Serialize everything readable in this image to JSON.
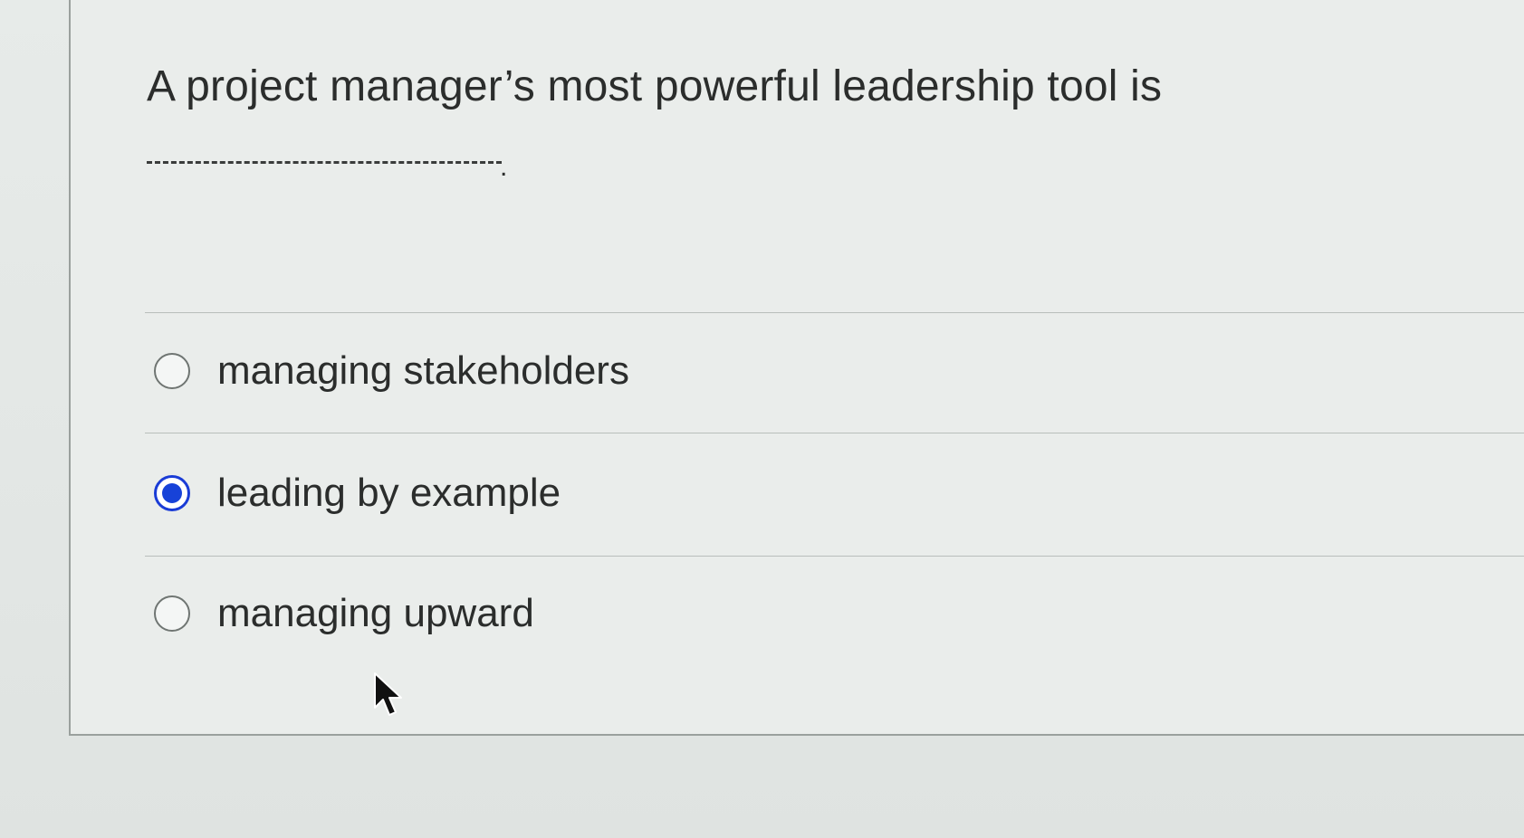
{
  "question": {
    "text": "A project manager’s most powerful leadership tool is",
    "blank_period": "."
  },
  "answers": [
    {
      "label": "managing stakeholders",
      "selected": false
    },
    {
      "label": "leading by example",
      "selected": true
    },
    {
      "label": "managing upward",
      "selected": false
    }
  ],
  "colors": {
    "selected_radio": "#1742d8",
    "text": "#2b2d2c"
  },
  "icons": {
    "cursor": "mouse-pointer-arrow-icon"
  }
}
